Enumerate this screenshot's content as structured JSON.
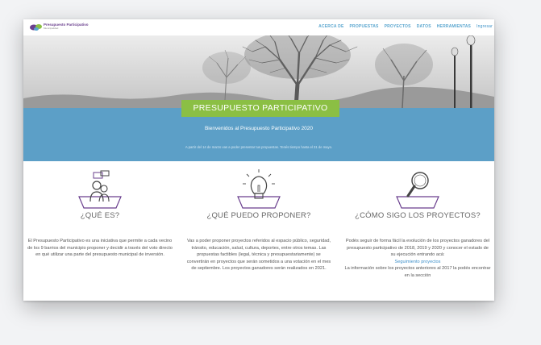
{
  "nav": {
    "logo_title": "Presupuesto Participativo",
    "logo_subtitle": "Municipalidad",
    "menu": [
      "ACERCA DE",
      "PROPUESTAS",
      "PROYECTOS",
      "DATOS",
      "HERRAMIENTAS"
    ],
    "login": "Ingresar"
  },
  "hero": {
    "title": "PRESUPUESTO PARTICIPATIVO",
    "welcome": "Bienvenidos al Presupuesto Participativo 2020",
    "notice": "A partir del 14 de marzo vas a poder presentar tus propuestas. Tenés tiempo hasta el 31 de mayo."
  },
  "columns": [
    {
      "icon": "people-icon",
      "heading": "¿QUÉ ES?",
      "text": "El Presupuesto Participativo es una iniciativa que permite a cada vecino de los 9 barrios del municipio proponer y decidir a través del voto directo en qué utilizar una parte del presupuesto municipal de inversión."
    },
    {
      "icon": "lightbulb-icon",
      "heading": "¿QUÉ PUEDO PROPONER?",
      "text": "Vas a poder proponer proyectos referidos al espacio público, seguridad, tránsito, educación, salud, cultura, deportes, entre otros temas. Las propuestas factibles (legal, técnica y presupuestariamente) se convertirán en proyectos que serán sometidos a una votación en el mes de septiembre. Los proyectos ganadores serán realizados en 2021."
    },
    {
      "icon": "magnifier-icon",
      "heading": "¿CÓMO SIGO LOS PROYECTOS?",
      "text": "Podés seguir de forma fácil la evolución de los proyectos ganadores del presupuesto participativo de 2018, 2019 y 2020 y conocer el estado de su ejecución entrando acá:",
      "link": "Seguimiento proyectos",
      "text2": "La información sobre los proyectos anteriores al 2017 la podés encontrar en la sección"
    }
  ],
  "colors": {
    "accent_blue": "#5c9fc7",
    "title_green": "#8bbf44",
    "icon_purple": "#6a3f8e",
    "link_blue": "#3d8fc9"
  }
}
